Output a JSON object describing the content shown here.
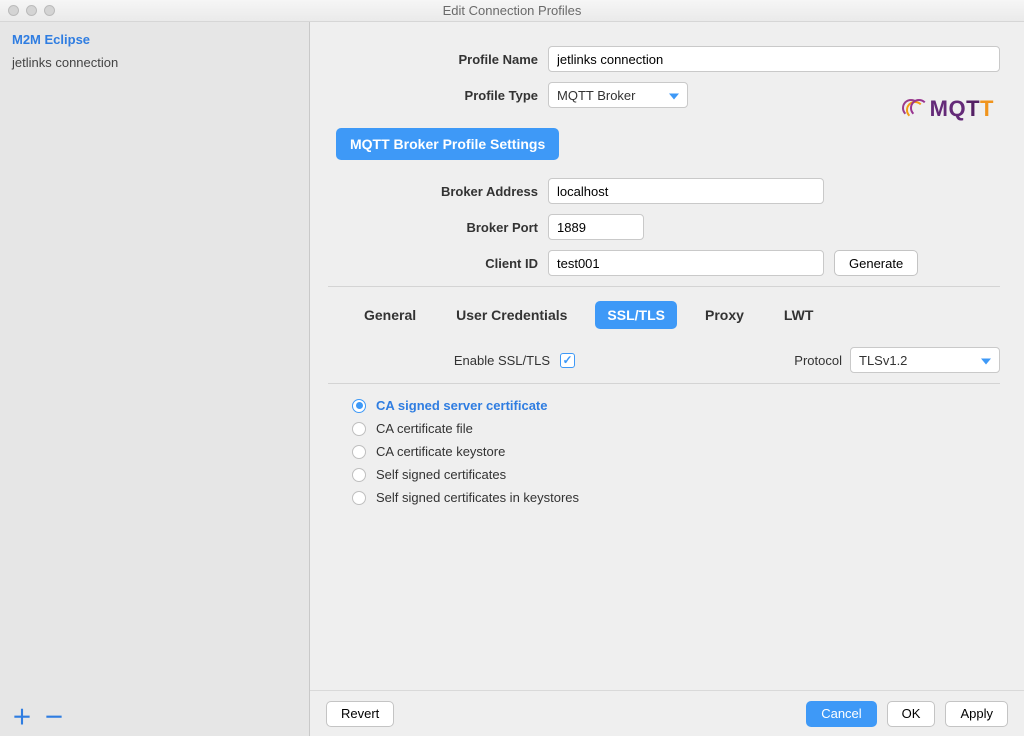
{
  "window": {
    "title": "Edit Connection Profiles"
  },
  "sidebar": {
    "items": [
      {
        "label": "M2M Eclipse",
        "selected": true
      },
      {
        "label": "jetlinks connection",
        "selected": false
      }
    ]
  },
  "form": {
    "profileName_label": "Profile Name",
    "profileName_value": "jetlinks connection",
    "profileType_label": "Profile Type",
    "profileType_value": "MQTT Broker",
    "section_heading": "MQTT Broker Profile Settings",
    "brokerAddress_label": "Broker Address",
    "brokerAddress_value": "localhost",
    "brokerPort_label": "Broker Port",
    "brokerPort_value": "1889",
    "clientId_label": "Client ID",
    "clientId_value": "test001",
    "generate_label": "Generate"
  },
  "tabs": [
    {
      "label": "General"
    },
    {
      "label": "User Credentials"
    },
    {
      "label": "SSL/TLS",
      "active": true
    },
    {
      "label": "Proxy"
    },
    {
      "label": "LWT"
    }
  ],
  "ssl": {
    "enable_label": "Enable SSL/TLS",
    "enable_checked": true,
    "protocol_label": "Protocol",
    "protocol_value": "TLSv1.2",
    "options": [
      {
        "label": "CA signed server certificate",
        "selected": true
      },
      {
        "label": "CA certificate file"
      },
      {
        "label": "CA certificate keystore"
      },
      {
        "label": "Self signed certificates"
      },
      {
        "label": "Self signed certificates in keystores"
      }
    ]
  },
  "logo": {
    "text": "MQTT"
  },
  "footer": {
    "revert": "Revert",
    "cancel": "Cancel",
    "ok": "OK",
    "apply": "Apply"
  }
}
